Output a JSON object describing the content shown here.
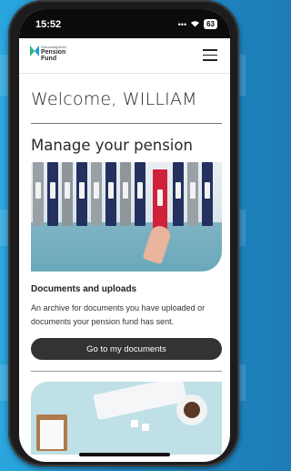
{
  "status": {
    "time": "15:52",
    "battery": "63"
  },
  "logo": {
    "small": "Gloucestershire",
    "line1": "Pension",
    "line2": "Fund"
  },
  "welcome": "Welcome, WILLIAM",
  "section_title": "Manage your pension",
  "card": {
    "title": "Documents and uploads",
    "description": "An archive for documents you have uploaded or documents your pension fund has sent.",
    "button": "Go to my documents"
  },
  "colors": {
    "button_bg": "#333333",
    "folder_red": "#d0213a",
    "folder_navy": "#24305e"
  }
}
